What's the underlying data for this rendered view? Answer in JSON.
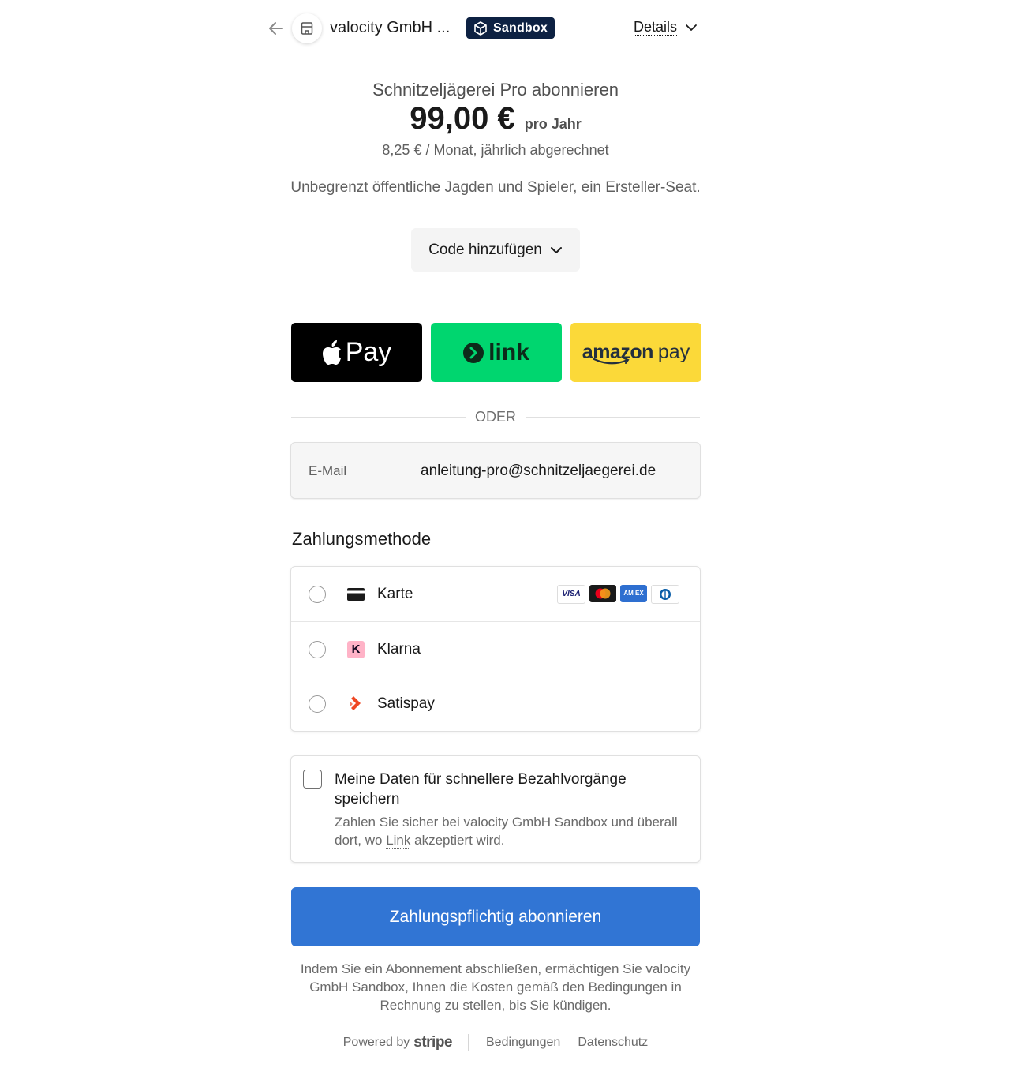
{
  "header": {
    "merchant_name": "valocity GmbH ...",
    "sandbox_badge": "Sandbox",
    "details_label": "Details"
  },
  "product": {
    "title": "Schnitzeljägerei Pro abonnieren",
    "price": "99,00 €",
    "period": "pro Jahr",
    "monthly_note": "8,25 € / Monat, jährlich abgerechnet",
    "description": "Unbegrenzt öffentliche Jagden und Spieler, ein Ersteller-Seat.",
    "code_button": "Code hinzufügen"
  },
  "express": {
    "apple_pay": "Pay",
    "link": "link",
    "amazon_word": "amazon",
    "amazon_pay": "pay"
  },
  "divider_text": "ODER",
  "email": {
    "label": "E-Mail",
    "value": "anleitung-pro@schnitzeljaegerei.de"
  },
  "payment_method": {
    "heading": "Zahlungsmethode",
    "options": [
      {
        "label": "Karte",
        "icon": "card-icon"
      },
      {
        "label": "Klarna",
        "icon": "klarna-icon"
      },
      {
        "label": "Satispay",
        "icon": "satispay-icon"
      }
    ],
    "card_brands": [
      "VISA",
      "Mastercard",
      "AMEX",
      "Diners"
    ],
    "card_brand_visa_text": "VISA",
    "card_brand_amex_text": "AM EX",
    "klarna_letter": "K"
  },
  "save_info": {
    "title": "Meine Daten für schnellere Bezahlvorgänge speichern",
    "subtitle_prefix": "Zahlen Sie sicher bei valocity GmbH Sandbox und überall dort, wo ",
    "subtitle_link": "Link",
    "subtitle_suffix": " akzeptiert wird."
  },
  "submit_label": "Zahlungspflichtig abonnieren",
  "legal_text": "Indem Sie ein Abonnement abschließen, ermächtigen Sie valocity GmbH Sandbox, Ihnen die Kosten gemäß den Bedingungen in Rechnung zu stellen, bis Sie kündigen.",
  "footer": {
    "powered_by": "Powered by",
    "stripe": "stripe",
    "terms": "Bedingungen",
    "privacy": "Datenschutz"
  },
  "colors": {
    "submit_blue": "#3175d4",
    "link_green": "#00d66f",
    "amazon_yellow": "#fbd939",
    "sandbox_navy": "#0d2142"
  }
}
